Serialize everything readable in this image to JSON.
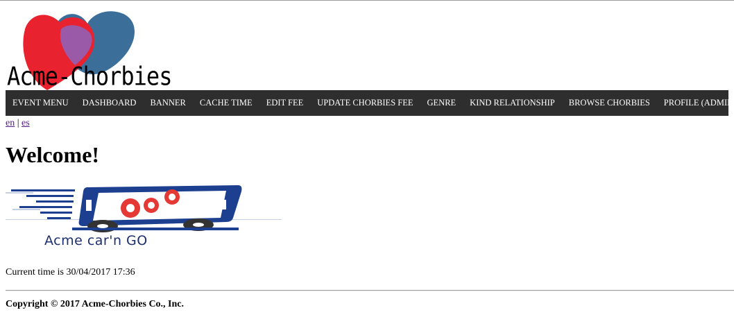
{
  "header": {
    "logo_text": "Acme-Chorbies"
  },
  "nav": {
    "items": [
      "EVENT MENU",
      "DASHBOARD",
      "BANNER",
      "CACHE TIME",
      "EDIT FEE",
      "UPDATE CHORBIES FEE",
      "GENRE",
      "KIND RELATIONSHIP",
      "BROWSE CHORBIES",
      "PROFILE (ADMIN)"
    ]
  },
  "language": {
    "en": "en",
    "separator": "|",
    "es": "es"
  },
  "main": {
    "title": "Welcome!",
    "banner_text": "Acme car'n GO",
    "current_time": "Current time is 30/04/2017 17:36"
  },
  "footer": {
    "copyright": "Copyright © 2017 Acme-Chorbies Co., Inc."
  },
  "colors": {
    "navbar_bg": "#2e2e2e",
    "heart_red": "#e8232f",
    "heart_blue": "#3b6f9a",
    "heart_overlap": "#9a5aa8",
    "banner_blue": "#1d3f8f",
    "gear_red": "#e53935"
  }
}
